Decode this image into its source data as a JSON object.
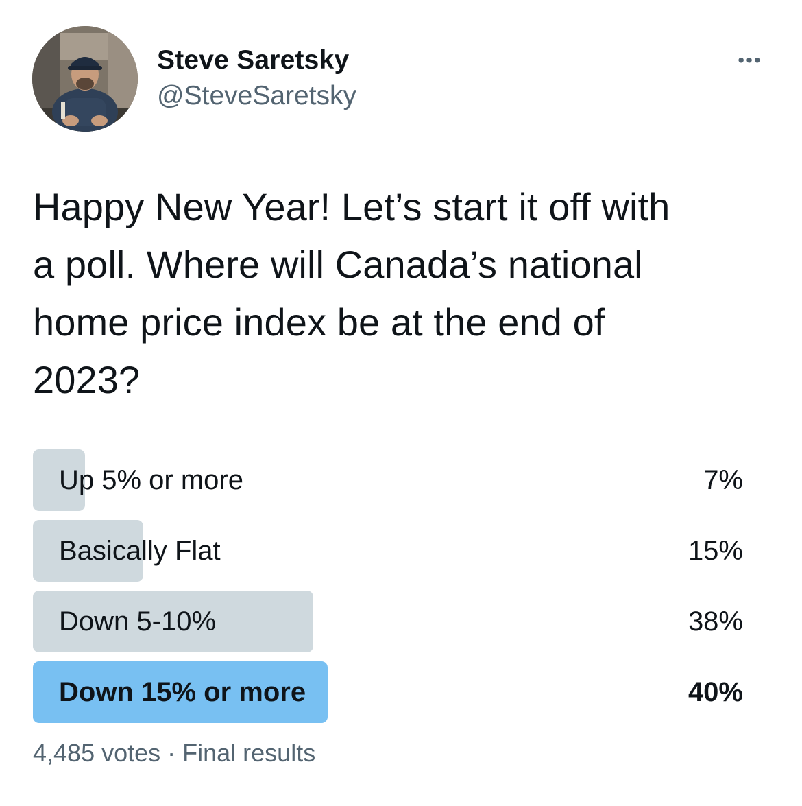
{
  "author": {
    "name": "Steve Saretsky",
    "handle": "@SteveSaretsky",
    "avatar_icon": "profile-photo-icon"
  },
  "more_icon": "more-dots-icon",
  "tweet": {
    "text_lines": [
      "Happy New Year! Let’s start it off with",
      "a poll. Where will Canada’s national",
      "home price index be at the end of",
      "2023?"
    ]
  },
  "poll": {
    "options": [
      {
        "label": "Up 5% or more",
        "percent_label": "7%",
        "fraction": 0.07,
        "winner": false
      },
      {
        "label": "Basically Flat",
        "percent_label": "15%",
        "fraction": 0.15,
        "winner": false
      },
      {
        "label": "Down 5-10%",
        "percent_label": "38%",
        "fraction": 0.38,
        "winner": false
      },
      {
        "label": "Down 15% or more",
        "percent_label": "40%",
        "fraction": 0.4,
        "winner": true
      }
    ],
    "votes": "4,485 votes",
    "separator": "·",
    "status": "Final results"
  },
  "colors": {
    "bar": "#cfd9de",
    "winner_bar": "#78c0f2",
    "secondary_text": "#536471",
    "primary_text": "#0f1419"
  }
}
